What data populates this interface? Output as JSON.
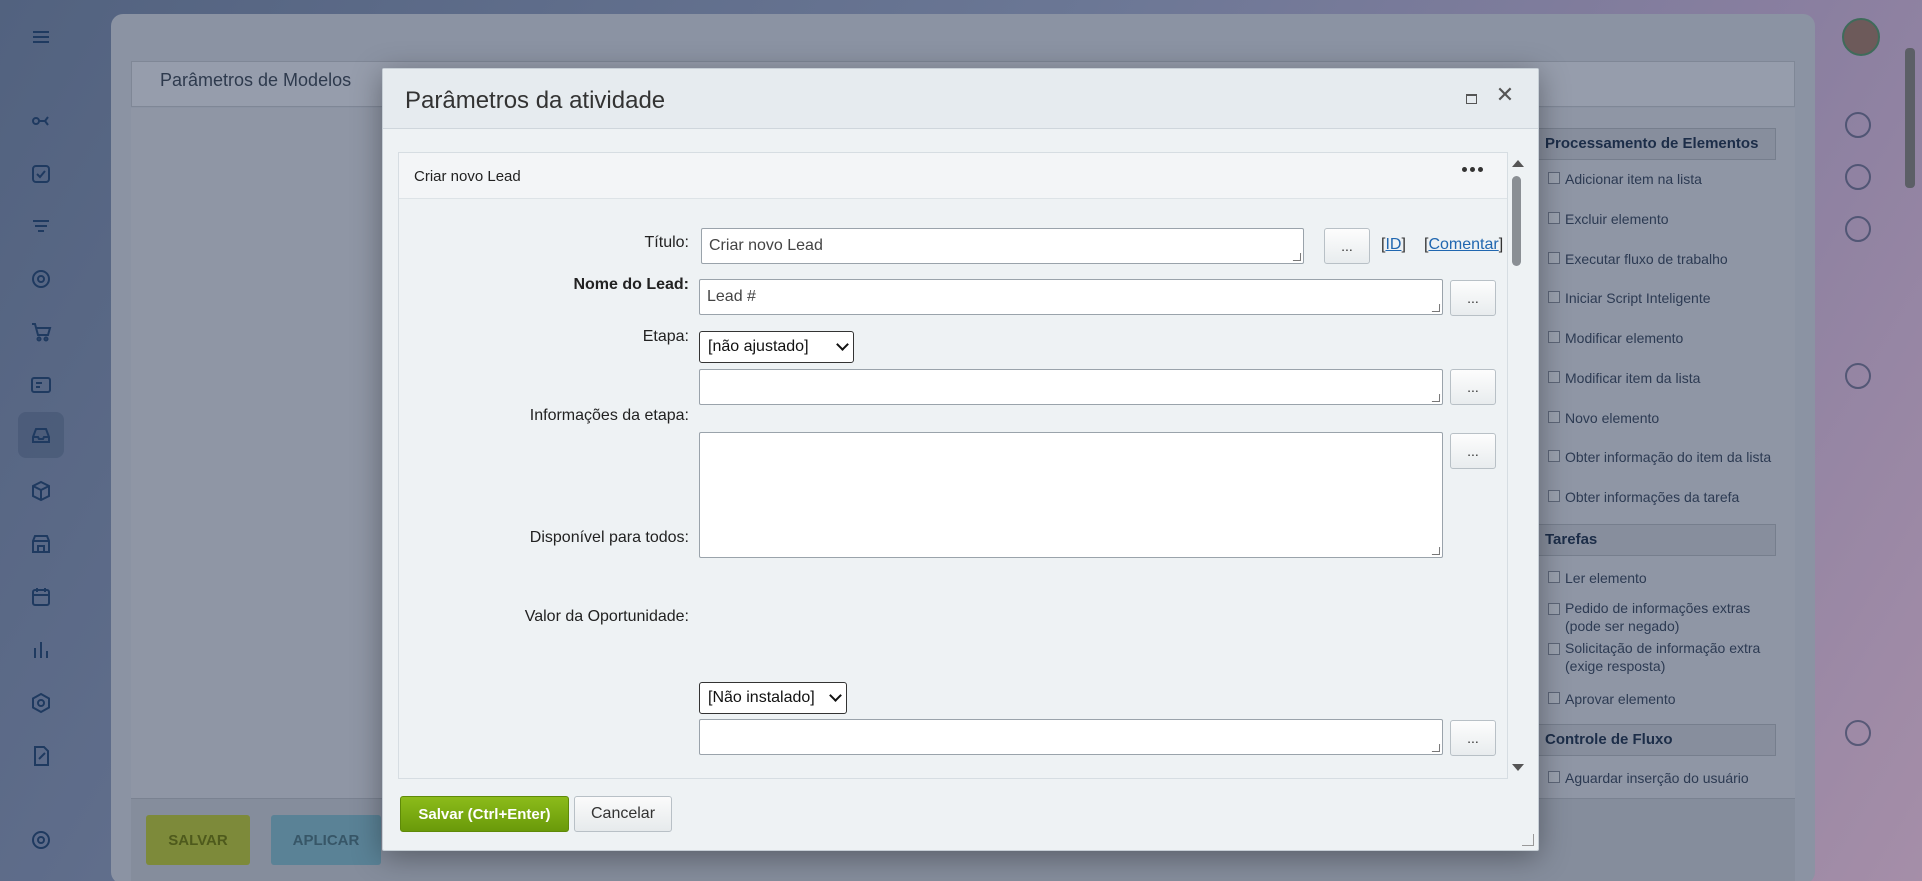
{
  "background": {
    "workspace_title": "Parâmetros de Modelos",
    "save_button": "SALVAR",
    "apply_button": "APLICAR",
    "right_panel": {
      "sections": [
        {
          "title": "Processamento de Elementos"
        },
        {
          "title": "Tarefas"
        },
        {
          "title": "Controle de Fluxo"
        }
      ],
      "items": [
        "Adicionar item na lista",
        "Excluir elemento",
        "Executar fluxo de trabalho",
        "Iniciar Script Inteligente",
        "Modificar elemento",
        "Modificar item da lista",
        "Novo elemento",
        "Obter informação do item da lista",
        "Obter informações da tarefa",
        "Ler elemento",
        "Pedido de informações extras (pode ser negado)",
        "Solicitação de informação extra (exige resposta)",
        "Aprovar elemento",
        "Aguardar inserção do usuário"
      ]
    }
  },
  "modal": {
    "title": "Parâmetros da atividade",
    "activity_name": "Criar novo Lead",
    "fields": {
      "titulo": {
        "label": "Título:",
        "value": "Criar novo Lead"
      },
      "nome_lead": {
        "label": "Nome do Lead:",
        "value": "Lead #"
      },
      "etapa": {
        "label": "Etapa:",
        "selected": "[não ajustado]",
        "value": ""
      },
      "info_etapa": {
        "label": "Informações da etapa:",
        "value": ""
      },
      "disponivel": {
        "label": "Disponível para todos:",
        "selected": "[Não instalado]",
        "value": ""
      },
      "valor": {
        "label": "Valor da Oportunidade:",
        "value": ""
      }
    },
    "id_link": "ID",
    "comment_link": "Comentar",
    "dots_label": "...",
    "save_button": "Salvar (Ctrl+Enter)",
    "cancel_button": "Cancelar"
  }
}
